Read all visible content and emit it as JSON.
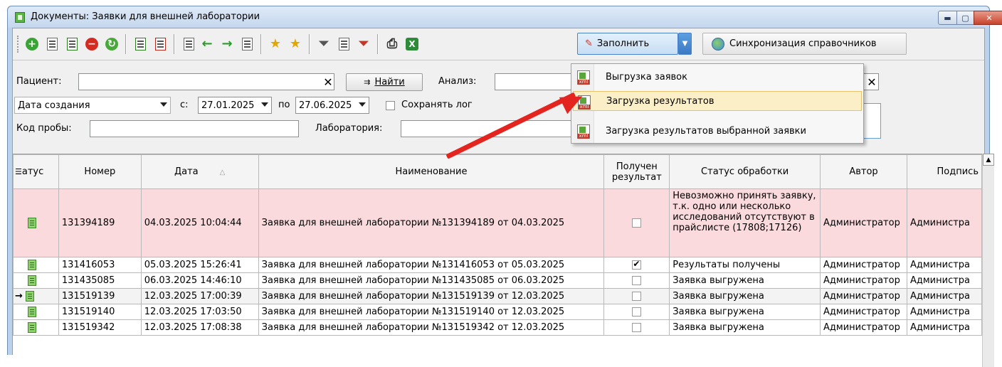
{
  "window": {
    "title": "Документы: Заявки для внешней лаборатории",
    "min_glyph": "▬",
    "max_glyph": "▢",
    "close_glyph": "✕"
  },
  "toolbar": {
    "fill_label": "Заполнить",
    "fill_arrow": "▼",
    "sync_label": "Синхронизация справочников"
  },
  "filters": {
    "patient_label": "Пациент:",
    "patient_value": "",
    "clear_glyph": "✕",
    "find_label": "Найти",
    "analysis_label": "Анализ:",
    "analysis_value": "",
    "date_type": "Дата создания",
    "from_label": "с:",
    "date_from": "27.01.2025",
    "to_label": "по",
    "date_to": "27.06.2025",
    "save_log_label": "Сохранять лог",
    "sample_code_label": "Код пробы:",
    "sample_code_value": "",
    "laboratory_label": "Лаборатория:",
    "laboratory_value": ""
  },
  "menu": {
    "items": [
      {
        "label": "Выгрузка заявок"
      },
      {
        "label": "Загрузка результатов"
      },
      {
        "label": "Загрузка результатов выбранной заявки"
      }
    ]
  },
  "grid": {
    "columns": [
      "Статус",
      "Номер",
      "Дата",
      "Наименование",
      "Получен результат",
      "Статус обработки",
      "Автор",
      "Подпись"
    ],
    "status_header_visible": "атус",
    "subscriber_header_visible": "Подпись",
    "sort_glyph": "△",
    "rows": [
      {
        "number": "131394189",
        "date": "04.03.2025 10:04:44",
        "name": "Заявка для внешней лаборатории №131394189 от 04.03.2025",
        "received": false,
        "processing": "Невозможно принять заявку, т.к. одно или несколько исследований отсутствуют в прайслисте (17808;17126)",
        "author": "Администратор",
        "signer": "Администра"
      },
      {
        "number": "131416053",
        "date": "05.03.2025 15:26:41",
        "name": "Заявка для внешней лаборатории №131416053 от 05.03.2025",
        "received": true,
        "processing": "Результаты получены",
        "author": "Администратор",
        "signer": "Администра"
      },
      {
        "number": "131435085",
        "date": "06.03.2025 14:46:10",
        "name": "Заявка для внешней лаборатории №131435085 от 06.03.2025",
        "received": false,
        "processing": "Заявка выгружена",
        "author": "Администратор",
        "signer": "Администра"
      },
      {
        "number": "131519139",
        "date": "12.03.2025 17:00:39",
        "name": "Заявка для внешней лаборатории №131519139 от 12.03.2025",
        "received": false,
        "processing": "Заявка выгружена",
        "author": "Администратор",
        "signer": "Администра"
      },
      {
        "number": "131519140",
        "date": "12.03.2025 17:03:50",
        "name": "Заявка для внешней лаборатории №131519140 от 12.03.2025",
        "received": false,
        "processing": "Заявка выгружена",
        "author": "Администратор",
        "signer": "Администра"
      },
      {
        "number": "131519342",
        "date": "12.03.2025 17:08:38",
        "name": "Заявка для внешней лаборатории №131519342 от 12.03.2025",
        "received": false,
        "processing": "Заявка выгружена",
        "author": "Администратор",
        "signer": "Администра"
      }
    ],
    "current_row_marker": "→"
  },
  "colors": {
    "error_row": "#fadadd",
    "menu_highlight": "#fbefc8",
    "annotation_arrow": "#e4251f"
  }
}
